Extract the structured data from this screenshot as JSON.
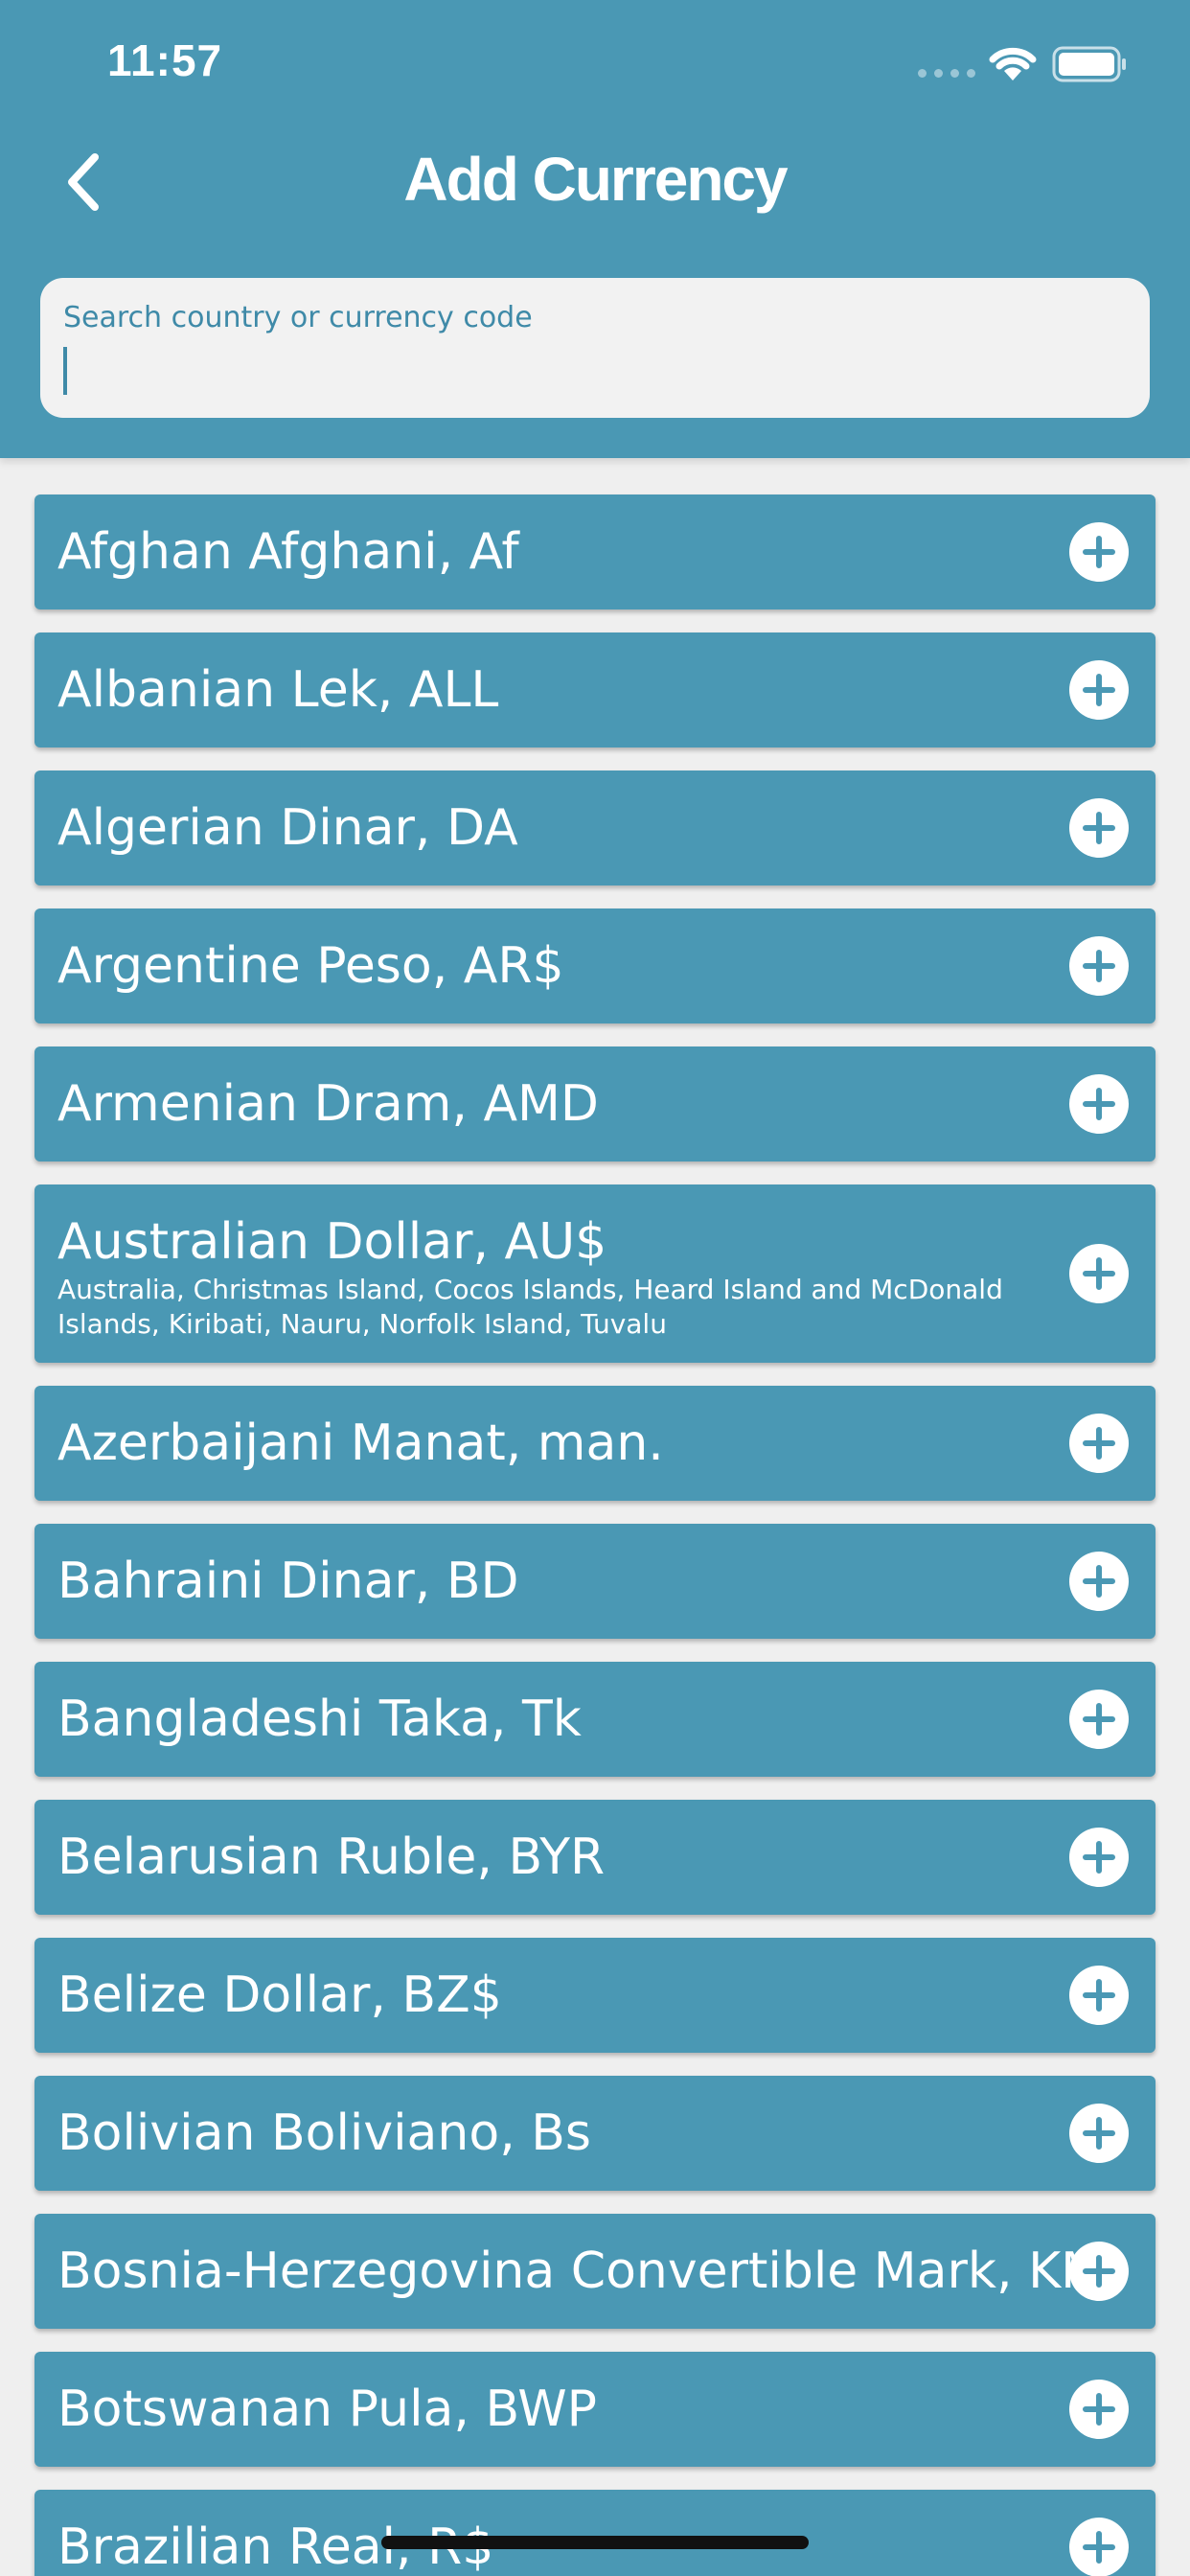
{
  "status_bar": {
    "time": "11:57"
  },
  "header": {
    "title": "Add Currency",
    "search_placeholder": "Search country or currency code"
  },
  "colors": {
    "header": "#4a98b4",
    "row": "#4a98b4",
    "background": "#efefef"
  },
  "currencies": [
    {
      "name": "Afghan Afghani, Af"
    },
    {
      "name": "Albanian Lek, ALL"
    },
    {
      "name": "Algerian Dinar, DA"
    },
    {
      "name": "Argentine Peso, AR$"
    },
    {
      "name": "Armenian Dram, AMD"
    },
    {
      "name": "Australian Dollar, AU$",
      "countries": "Australia, Christmas Island, Cocos Islands, Heard Island and McDonald Islands, Kiribati, Nauru, Norfolk Island, Tuvalu"
    },
    {
      "name": "Azerbaijani Manat, man."
    },
    {
      "name": "Bahraini Dinar, BD"
    },
    {
      "name": "Bangladeshi Taka, Tk"
    },
    {
      "name": "Belarusian Ruble, BYR"
    },
    {
      "name": "Belize Dollar, BZ$"
    },
    {
      "name": "Bolivian Boliviano, Bs"
    },
    {
      "name": "Bosnia-Herzegovina Convertible Mark, KM"
    },
    {
      "name": "Botswanan Pula, BWP"
    },
    {
      "name": "Brazilian Real, R$"
    }
  ],
  "icons": {
    "back": "chevron-left-icon",
    "add": "plus-circle-icon"
  }
}
